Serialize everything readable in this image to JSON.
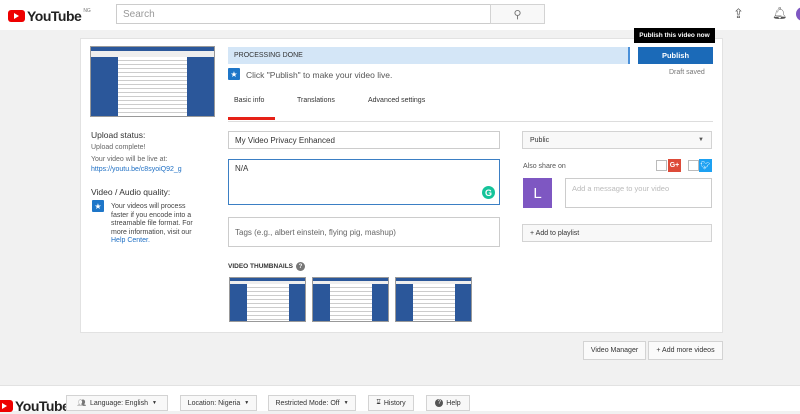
{
  "header": {
    "logo": "YouTube",
    "region": "NG",
    "search_placeholder": "Search",
    "icons": [
      "search-icon",
      "upload-icon",
      "bell-icon",
      "avatar"
    ]
  },
  "card": {
    "processing": "PROCESSING DONE",
    "tooltip": "Publish this video now",
    "publish": "Publish",
    "draft": "Draft saved",
    "hint": "Click \"Publish\" to make your video live.",
    "tabs": [
      "Basic info",
      "Translations",
      "Advanced settings"
    ],
    "title_value": "My Video Privacy Enhanced",
    "description_value": "N/A",
    "tags_placeholder": "Tags (e.g., albert einstein, flying pig, mashup)",
    "thumbs_label": "VIDEO THUMBNAILS",
    "privacy": "Public",
    "share_label": "Also share on",
    "avatar_letter": "L",
    "message_placeholder": "Add a message to your video",
    "playlist": "+ Add to playlist",
    "upload_status_title": "Upload status:",
    "upload_complete": "Upload complete!",
    "live_at": "Your video will be live at:",
    "link": "https://youtu.be/c8syoiQ92_g",
    "quality_title": "Video / Audio quality:",
    "quality_text": "Your videos will process faster if you encode into a streamable file format. For more information, visit our",
    "help_center": "Help Center."
  },
  "actions": {
    "video_manager": "Video Manager",
    "add_more": "+ Add more videos"
  },
  "footer": {
    "logo": "YouTube",
    "language": "Language: English",
    "location": "Location: Nigeria",
    "restricted": "Restricted Mode: Off",
    "history": "History",
    "help": "Help"
  }
}
